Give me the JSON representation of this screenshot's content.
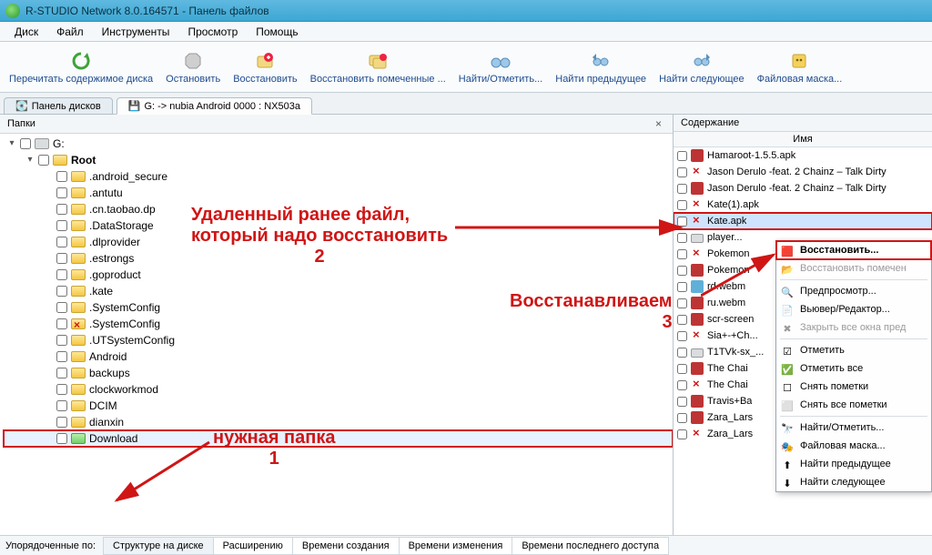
{
  "window": {
    "title": "R-STUDIO Network 8.0.164571 - Панель файлов"
  },
  "menu": {
    "disk": "Диск",
    "file": "Файл",
    "tools": "Инструменты",
    "view": "Просмотр",
    "help": "Помощь"
  },
  "toolbar": {
    "reread": "Перечитать содержимое диска",
    "stop": "Остановить",
    "recover": "Восстановить",
    "recover_marked": "Восстановить помеченные ...",
    "find": "Найти/Отметить...",
    "find_prev": "Найти предыдущее",
    "find_next": "Найти следующее",
    "filemask": "Файловая маска..."
  },
  "tabs": {
    "panel": "Панель дисков",
    "drive": "G: -> nubia Android 0000 : NX503a"
  },
  "left": {
    "header": "Папки",
    "nodes": [
      {
        "lvl": 0,
        "exp": "▾",
        "icon": "drive",
        "label": "G:"
      },
      {
        "lvl": 1,
        "exp": "▾",
        "icon": "folder",
        "label": "Root",
        "bold": true
      },
      {
        "lvl": 2,
        "exp": "",
        "icon": "folder",
        "label": ".android_secure"
      },
      {
        "lvl": 2,
        "exp": "",
        "icon": "folder",
        "label": ".antutu"
      },
      {
        "lvl": 2,
        "exp": "",
        "icon": "folder",
        "label": ".cn.taobao.dp"
      },
      {
        "lvl": 2,
        "exp": "",
        "icon": "folder",
        "label": ".DataStorage"
      },
      {
        "lvl": 2,
        "exp": "",
        "icon": "folder",
        "label": ".dlprovider"
      },
      {
        "lvl": 2,
        "exp": "",
        "icon": "folder",
        "label": ".estrongs"
      },
      {
        "lvl": 2,
        "exp": "",
        "icon": "folder",
        "label": ".goproduct"
      },
      {
        "lvl": 2,
        "exp": "",
        "icon": "folder",
        "label": ".kate"
      },
      {
        "lvl": 2,
        "exp": "",
        "icon": "folder",
        "label": ".SystemConfig"
      },
      {
        "lvl": 2,
        "exp": "",
        "icon": "folder-del",
        "label": ".SystemConfig"
      },
      {
        "lvl": 2,
        "exp": "",
        "icon": "folder",
        "label": ".UTSystemConfig"
      },
      {
        "lvl": 2,
        "exp": "",
        "icon": "folder",
        "label": "Android"
      },
      {
        "lvl": 2,
        "exp": "",
        "icon": "folder",
        "label": "backups"
      },
      {
        "lvl": 2,
        "exp": "",
        "icon": "folder",
        "label": "clockworkmod"
      },
      {
        "lvl": 2,
        "exp": "",
        "icon": "folder",
        "label": "DCIM"
      },
      {
        "lvl": 2,
        "exp": "",
        "icon": "folder",
        "label": "dianxin"
      },
      {
        "lvl": 2,
        "exp": "",
        "icon": "folder-green",
        "label": "Download",
        "boxed": true,
        "hl": true
      }
    ]
  },
  "right": {
    "header": "Содержание",
    "col": "Имя",
    "rows": [
      {
        "icon": "apk",
        "label": "Hamaroot-1.5.5.apk"
      },
      {
        "icon": "del",
        "label": "Jason Derulo -feat. 2 Chainz – Talk Dirty"
      },
      {
        "icon": "apk",
        "label": "Jason Derulo -feat. 2 Chainz – Talk Dirty"
      },
      {
        "icon": "del",
        "label": "Kate(1).apk"
      },
      {
        "icon": "del",
        "label": "Kate.apk",
        "boxed": true,
        "sel": true
      },
      {
        "icon": "disk",
        "label": "player..."
      },
      {
        "icon": "del",
        "label": "Pokemon"
      },
      {
        "icon": "apk",
        "label": "Pokemon"
      },
      {
        "icon": "video",
        "label": "rd.webm"
      },
      {
        "icon": "apk",
        "label": "ru.webm"
      },
      {
        "icon": "apk",
        "label": "scr-screen"
      },
      {
        "icon": "del",
        "label": "Sia+-+Ch..."
      },
      {
        "icon": "disk",
        "label": "T1TVk-sx_..."
      },
      {
        "icon": "apk",
        "label": "The Chai"
      },
      {
        "icon": "del",
        "label": "The Chai"
      },
      {
        "icon": "apk",
        "label": "Travis+Ba"
      },
      {
        "icon": "apk",
        "label": "Zara_Lars"
      },
      {
        "icon": "del",
        "label": "Zara_Lars"
      }
    ]
  },
  "ctx": {
    "recover": "Восстановить...",
    "recover_marked": "Восстановить помечен",
    "preview": "Предпросмотр...",
    "viewer": "Вьювер/Редактор...",
    "close_all": "Закрыть все окна пред",
    "mark": "Отметить",
    "mark_all": "Отметить все",
    "unmark": "Снять пометки",
    "unmark_all": "Снять все пометки",
    "find": "Найти/Отметить...",
    "filemask": "Файловая маска...",
    "find_prev": "Найти предыдущее",
    "find_next": "Найти следующее"
  },
  "sortbar": {
    "label": "Упорядоченные по:",
    "structure": "Структуре на диске",
    "ext": "Расширению",
    "ctime": "Времени создания",
    "mtime": "Времени изменения",
    "atime": "Времени последнего доступа"
  },
  "anno": {
    "line1": "Удаленный ранее файл,",
    "line2": "который надо восстановить",
    "num2": "2",
    "restore": "Восстанавливаем",
    "num3": "3",
    "folder": "нужная папка",
    "num1": "1"
  }
}
